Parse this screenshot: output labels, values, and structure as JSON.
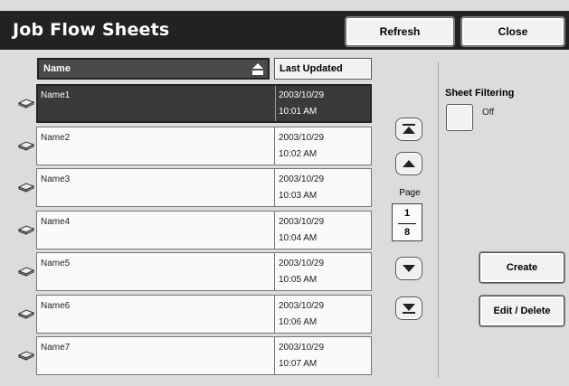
{
  "title": "Job Flow Sheets",
  "toolbar": {
    "refresh_label": "Refresh",
    "close_label": "Close"
  },
  "table": {
    "headers": {
      "name": "Name",
      "updated": "Last Updated"
    },
    "rows": [
      {
        "name": "Name1",
        "date": "2003/10/29",
        "time": "10:01 AM",
        "selected": true
      },
      {
        "name": "Name2",
        "date": "2003/10/29",
        "time": "10:02 AM",
        "selected": false
      },
      {
        "name": "Name3",
        "date": "2003/10/29",
        "time": "10:03 AM",
        "selected": false
      },
      {
        "name": "Name4",
        "date": "2003/10/29",
        "time": "10:04 AM",
        "selected": false
      },
      {
        "name": "Name5",
        "date": "2003/10/29",
        "time": "10:05 AM",
        "selected": false
      },
      {
        "name": "Name6",
        "date": "2003/10/29",
        "time": "10:06 AM",
        "selected": false
      },
      {
        "name": "Name7",
        "date": "2003/10/29",
        "time": "10:07 AM",
        "selected": false
      }
    ],
    "row_icon": "document-tray-icon"
  },
  "pager": {
    "label": "Page",
    "current": "1",
    "total": "8"
  },
  "filter": {
    "label": "Sheet Filtering",
    "value": "Off"
  },
  "actions": {
    "create_label": "Create",
    "edit_label": "Edit / Delete"
  }
}
